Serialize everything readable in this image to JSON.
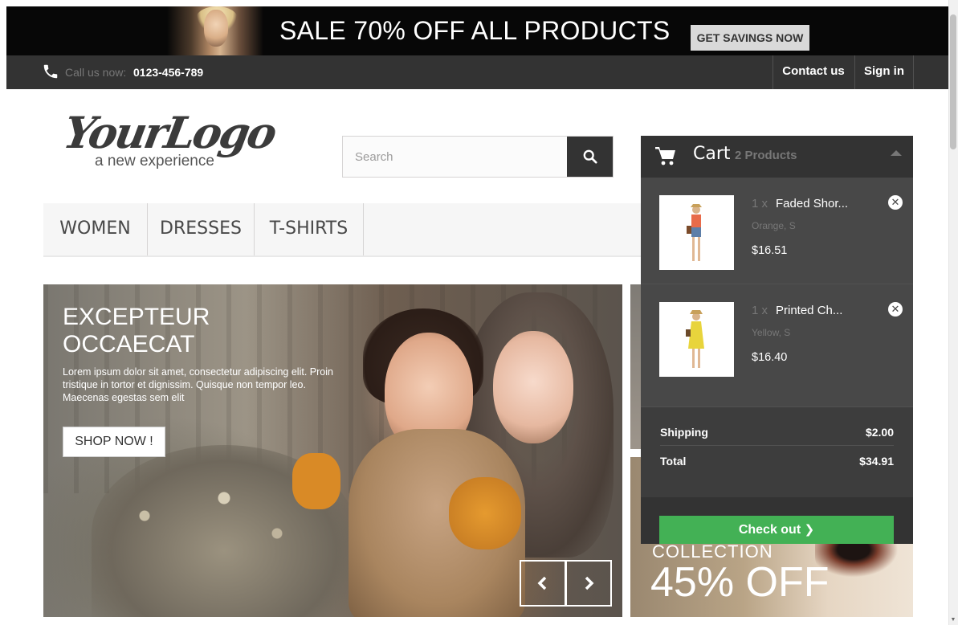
{
  "banner": {
    "headline": "SALE 70% OFF ALL PRODUCTS",
    "button": "GET SAVINGS NOW"
  },
  "topnav": {
    "call_label": "Call us now:",
    "phone": "0123-456-789",
    "contact": "Contact us",
    "signin": "Sign in",
    "phone_icon": "phone-icon"
  },
  "logo": {
    "script": "YourLogo",
    "tagline": "a new experience"
  },
  "search": {
    "placeholder": "Search",
    "icon": "search-icon"
  },
  "menu": {
    "items": [
      "WOMEN",
      "DRESSES",
      "T-SHIRTS"
    ]
  },
  "hero": {
    "title": "EXCEPTEUR OCCAECAT",
    "text": "Lorem ipsum dolor sit amet, consectetur adipiscing elit. Proin tristique in tortor et dignissim. Quisque non tempor leo. Maecenas egestas sem elit",
    "button": "SHOP NOW !",
    "prev_icon": "chevron-left-icon",
    "next_icon": "chevron-right-icon"
  },
  "ad": {
    "line1": "COLLECTION",
    "line2": "45% OFF"
  },
  "cart": {
    "title": "Cart",
    "count": "2 Products",
    "items": [
      {
        "qty": "1 x",
        "name": "Faded Shor...",
        "attributes": "Orange, S",
        "price": "$16.51"
      },
      {
        "qty": "1 x",
        "name": "Printed Ch...",
        "attributes": "Yellow, S",
        "price": "$16.40"
      }
    ],
    "shipping_label": "Shipping",
    "shipping_value": "$2.00",
    "total_label": "Total",
    "total_value": "$34.91",
    "checkout": "Check out",
    "checkout_icon": "chevron-right-icon"
  },
  "colors": {
    "dark": "#333333",
    "cart_bg": "#484848",
    "checkout_green": "#43b155"
  }
}
